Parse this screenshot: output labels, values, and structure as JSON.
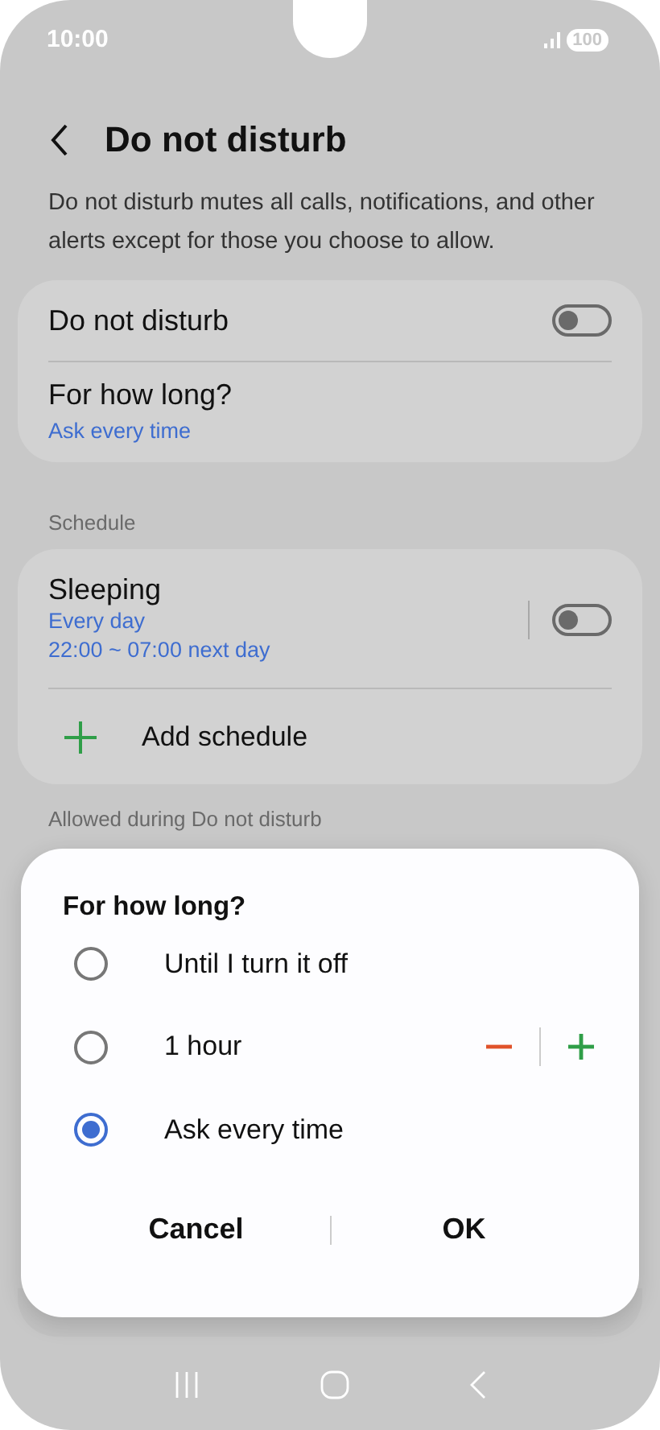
{
  "status_bar": {
    "time": "10:00",
    "battery": "100"
  },
  "header": {
    "title": "Do not disturb"
  },
  "description": "Do not disturb mutes all calls, notifications, and other alerts except for those you choose to allow.",
  "main_card": {
    "toggle": {
      "label": "Do not disturb",
      "on": false
    },
    "duration": {
      "label": "For how long?",
      "value": "Ask every time"
    }
  },
  "schedule": {
    "heading": "Schedule",
    "items": [
      {
        "name": "Sleeping",
        "days": "Every day",
        "time": "22:00 ~ 07:00 next day",
        "on": false
      }
    ],
    "add_label": "Add schedule"
  },
  "allowed_heading": "Allowed during Do not disturb",
  "dialog": {
    "title": "For how long?",
    "options": [
      {
        "label": "Until I turn it off",
        "selected": false,
        "kind": "plain"
      },
      {
        "label": "1 hour",
        "selected": false,
        "kind": "stepper"
      },
      {
        "label": "Ask every time",
        "selected": true,
        "kind": "plain"
      }
    ],
    "buttons": [
      "Cancel",
      "OK"
    ]
  }
}
